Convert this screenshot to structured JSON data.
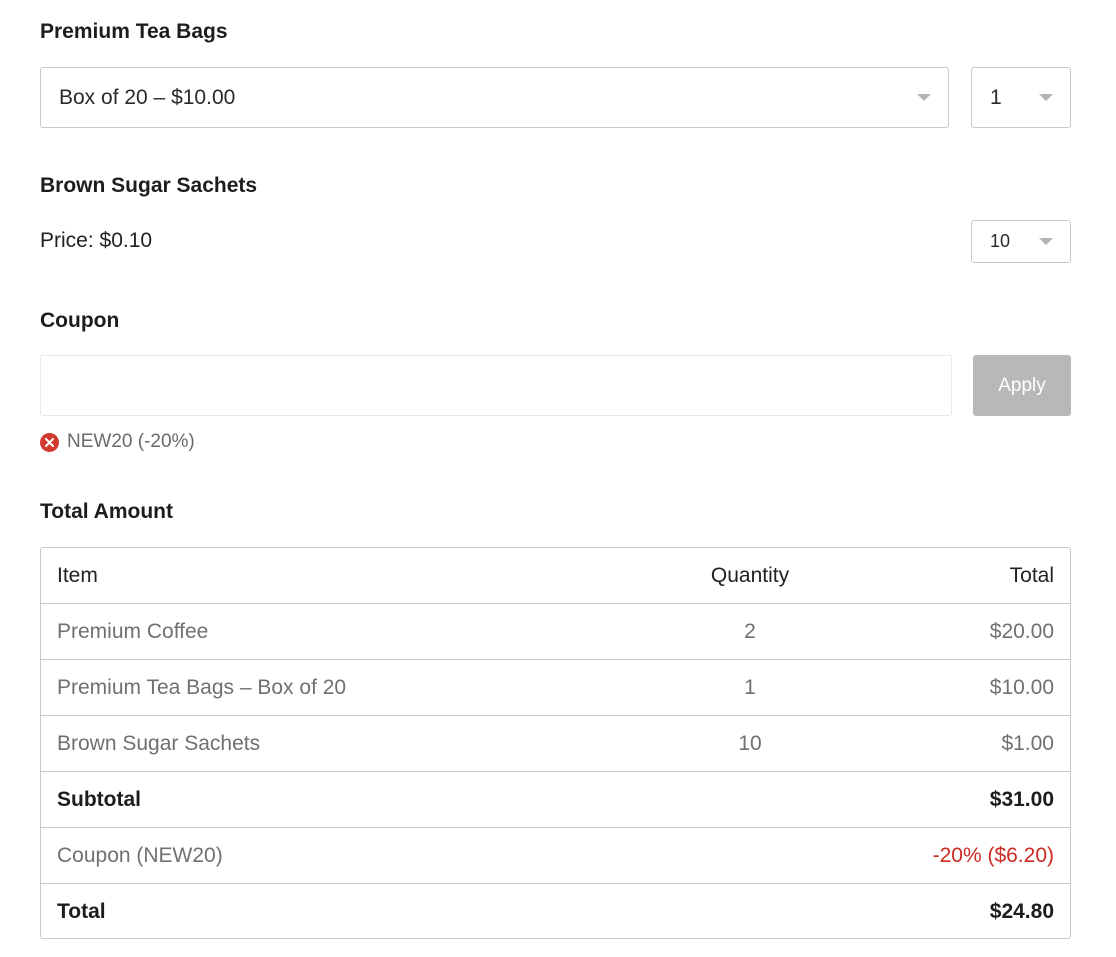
{
  "tea": {
    "heading": "Premium Tea Bags",
    "option_selected": "Box of 20 – $10.00",
    "quantity_selected": "1"
  },
  "sugar": {
    "heading": "Brown Sugar Sachets",
    "price_text": "Price: $0.10",
    "quantity_selected": "10"
  },
  "coupon": {
    "heading": "Coupon",
    "input_value": "",
    "apply_label": "Apply",
    "applied_tag": "NEW20 (-20%)"
  },
  "summary": {
    "heading": "Total Amount",
    "columns": [
      "Item",
      "Quantity",
      "Total"
    ],
    "rows": [
      {
        "item": "Premium Coffee",
        "quantity": "2",
        "total": "$20.00"
      },
      {
        "item": "Premium Tea Bags – Box of 20",
        "quantity": "1",
        "total": "$10.00"
      },
      {
        "item": "Brown Sugar Sachets",
        "quantity": "10",
        "total": "$1.00"
      }
    ],
    "subtotal_label": "Subtotal",
    "subtotal_value": "$31.00",
    "coupon_label": "Coupon (NEW20)",
    "coupon_value": "-20% ($6.20)",
    "total_label": "Total",
    "total_value": "$24.80"
  },
  "colors": {
    "discount": "#cc2a22",
    "remove_icon": "#d03a30",
    "apply_button_disabled": "#b8b8b8"
  }
}
